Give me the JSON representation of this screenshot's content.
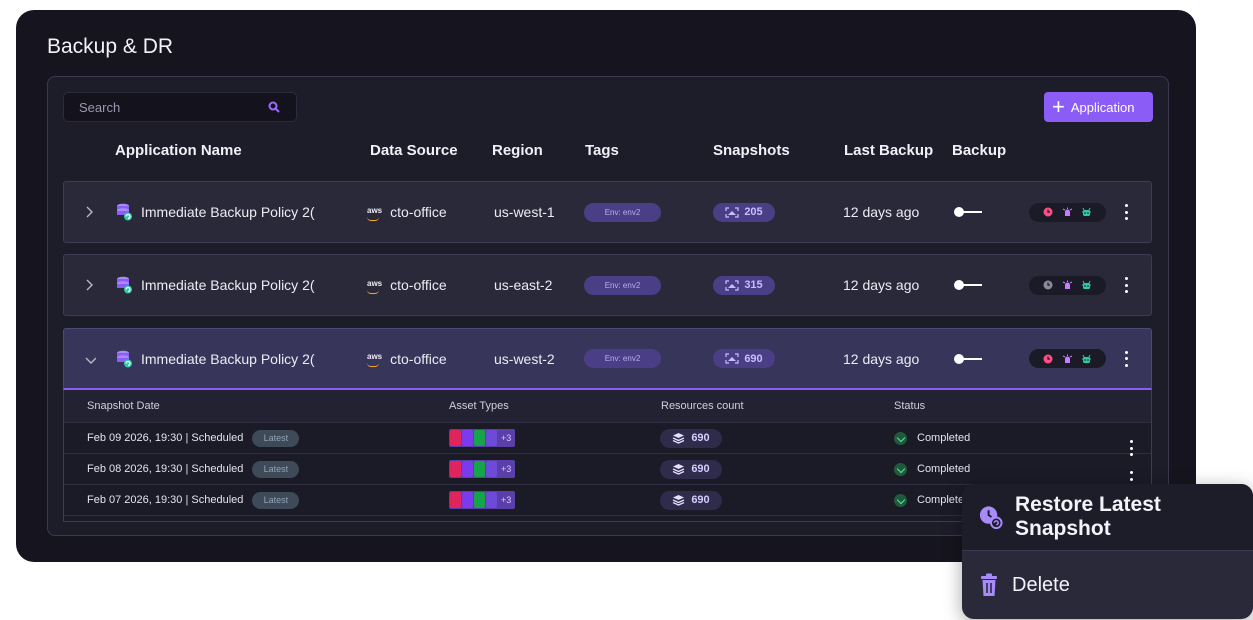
{
  "page": {
    "title": "Backup & DR"
  },
  "toolbar": {
    "search_placeholder": "Search",
    "add_label": "Application"
  },
  "columns": {
    "app_name": "Application Name",
    "data_source": "Data Source",
    "region": "Region",
    "tags": "Tags",
    "snapshots": "Snapshots",
    "last_backup": "Last Backup",
    "backup": "Backup"
  },
  "rows": [
    {
      "name": "Immediate Backup Policy 2(",
      "source_logo": "aws",
      "source": "cto-office",
      "region": "us-west-1",
      "tag": "Env: env2",
      "snapshots": "205",
      "last_backup": "12 days ago",
      "expanded": false
    },
    {
      "name": "Immediate Backup Policy 2(",
      "source_logo": "aws",
      "source": "cto-office",
      "region": "us-east-2",
      "tag": "Env: env2",
      "snapshots": "315",
      "last_backup": "12 days ago",
      "expanded": false
    },
    {
      "name": "Immediate Backup Policy 2(",
      "source_logo": "aws",
      "source": "cto-office",
      "region": "us-west-2",
      "tag": "Env: env2",
      "snapshots": "690",
      "last_backup": "12 days ago",
      "expanded": true
    }
  ],
  "snapshot_table": {
    "headers": {
      "date": "Snapshot Date",
      "asset_types": "Asset Types",
      "resources": "Resources count",
      "status": "Status"
    },
    "rows": [
      {
        "date": "Feb 09 2026, 19:30 | Scheduled",
        "badge": "Latest",
        "assets_more": "+3",
        "resources": "690",
        "status": "Completed"
      },
      {
        "date": "Feb 08 2026, 19:30 | Scheduled",
        "badge": "Latest",
        "assets_more": "+3",
        "resources": "690",
        "status": "Completed"
      },
      {
        "date": "Feb 07 2026, 19:30 | Scheduled",
        "badge": "Latest",
        "assets_more": "+3",
        "resources": "690",
        "status": "Complete"
      }
    ]
  },
  "context_menu": {
    "restore": "Restore Latest Snapshot",
    "delete": "Delete"
  },
  "colors": {
    "accent": "#8b5cf6",
    "bg": "#16151f",
    "success": "#5ee49b",
    "alert": "#ff4d88"
  }
}
